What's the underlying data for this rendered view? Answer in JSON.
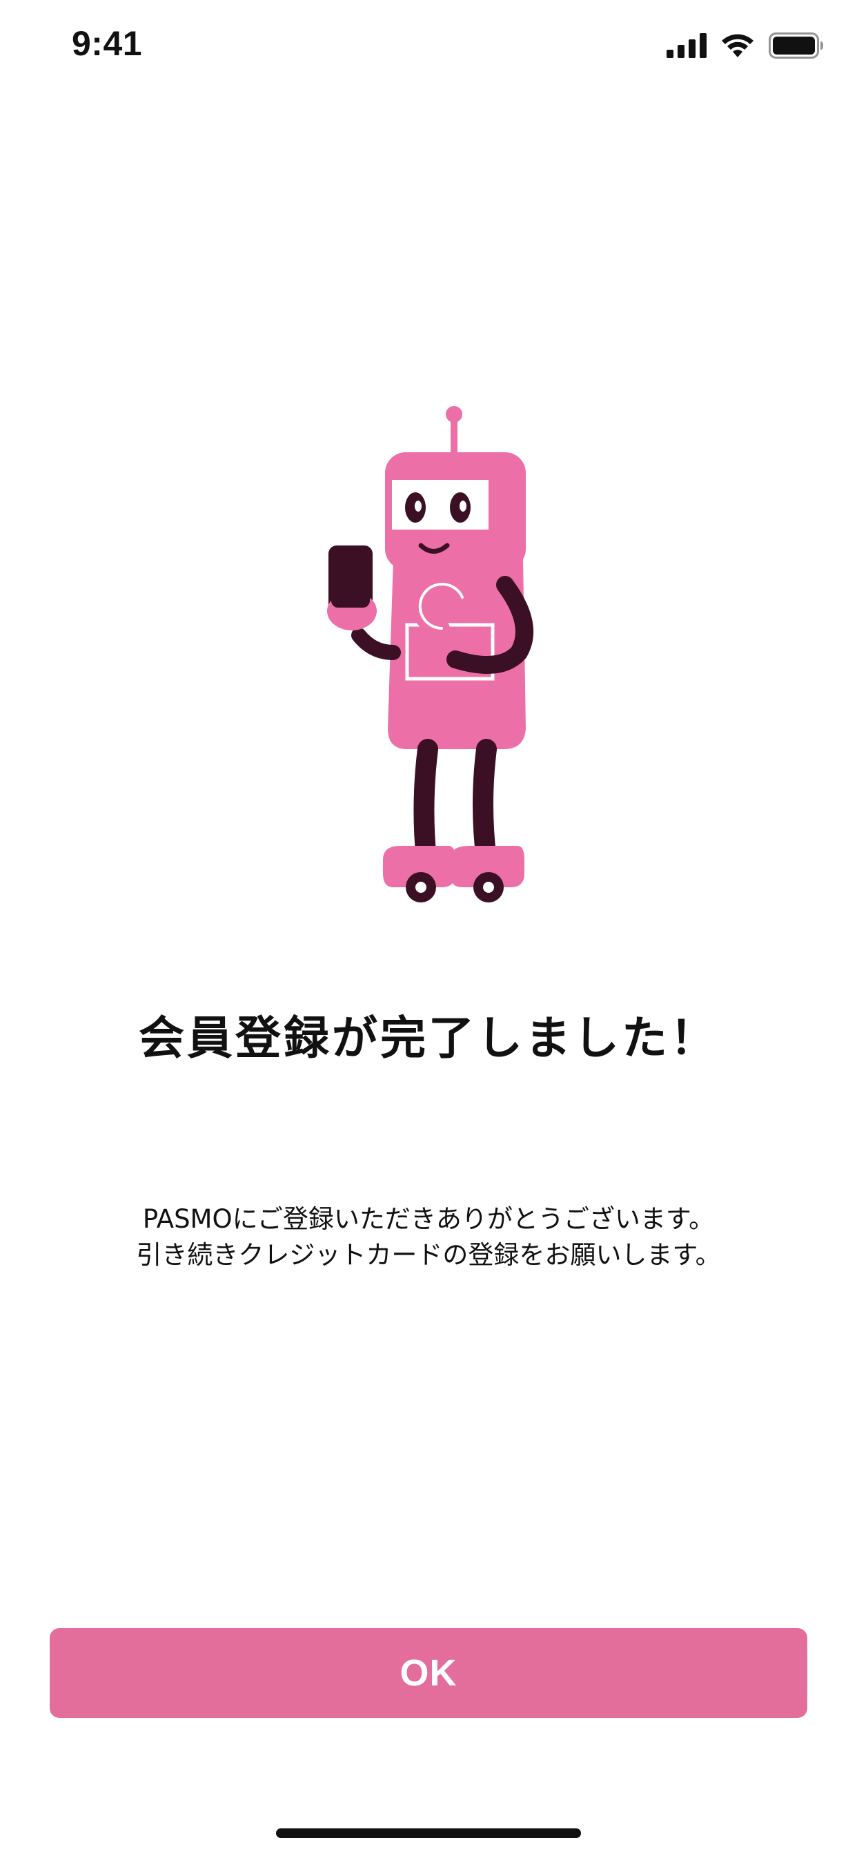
{
  "status_bar": {
    "time": "9:41",
    "icons": [
      "cellular-signal-icon",
      "wifi-icon",
      "battery-icon"
    ]
  },
  "illustration": {
    "name": "robot-mascot-holding-phone",
    "colors": {
      "body": "#ec70a7",
      "limbs": "#3b1024",
      "face_panel": "#ffffff"
    }
  },
  "main": {
    "title": "会員登録が完了しました！",
    "message_lines": [
      "PASMOにご登録いただきありがとうございます。",
      "引き続きクレジットカードの登録をお願いします。"
    ]
  },
  "actions": {
    "ok_label": "OK"
  },
  "theme": {
    "accent": "#e36e9c",
    "text": "#111111",
    "background": "#ffffff"
  }
}
